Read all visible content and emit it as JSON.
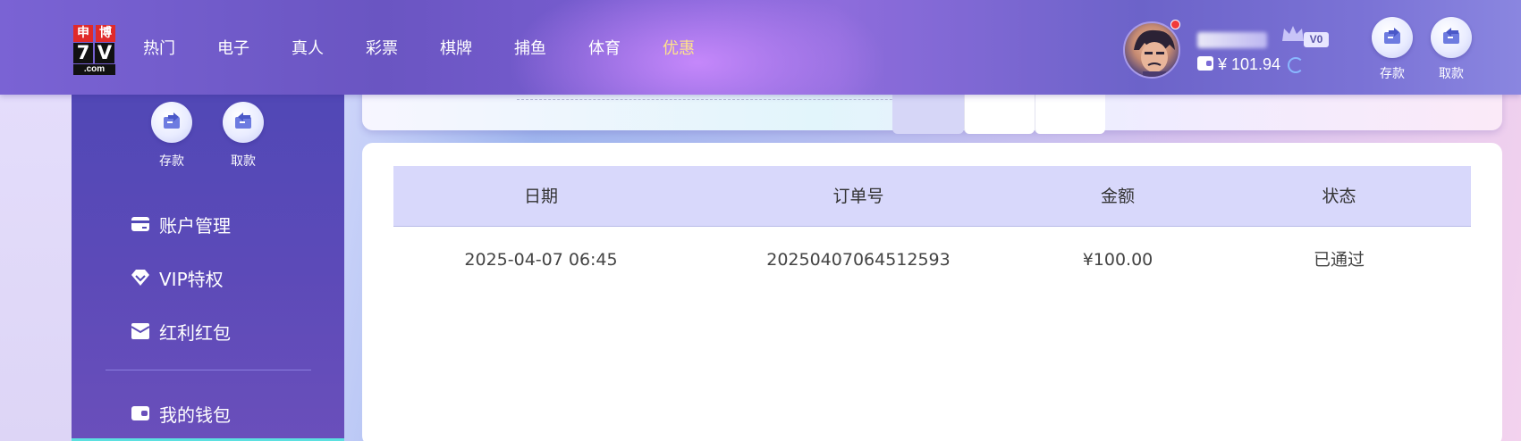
{
  "logo": {
    "cn_left": "申",
    "cn_right": "博",
    "num_left": "7",
    "num_right": "V",
    "suffix": ".com"
  },
  "nav": {
    "items": [
      "热门",
      "电子",
      "真人",
      "彩票",
      "棋牌",
      "捕鱼",
      "体育",
      "优惠"
    ],
    "active": "优惠"
  },
  "user": {
    "vip_level": "V0",
    "balance": "¥ 101.94"
  },
  "header_actions": {
    "deposit": "存款",
    "withdraw": "取款"
  },
  "sidebar": {
    "deposit": "存款",
    "withdraw": "取款",
    "items": [
      {
        "label": "账户管理",
        "icon": "card-icon"
      },
      {
        "label": "VIP特权",
        "icon": "diamond-icon"
      },
      {
        "label": "红利红包",
        "icon": "envelope-icon"
      },
      {
        "label": "我的钱包",
        "icon": "wallet-icon"
      }
    ]
  },
  "table": {
    "headers": [
      "日期",
      "订单号",
      "金额",
      "状态"
    ],
    "rows": [
      [
        "2025-04-07 06:45",
        "20250407064512593",
        "¥100.00",
        "已通过"
      ]
    ]
  },
  "colors": {
    "accent": "#ffe38a",
    "sidebar": "#5148b6",
    "table_header": "#d8d8fb"
  }
}
